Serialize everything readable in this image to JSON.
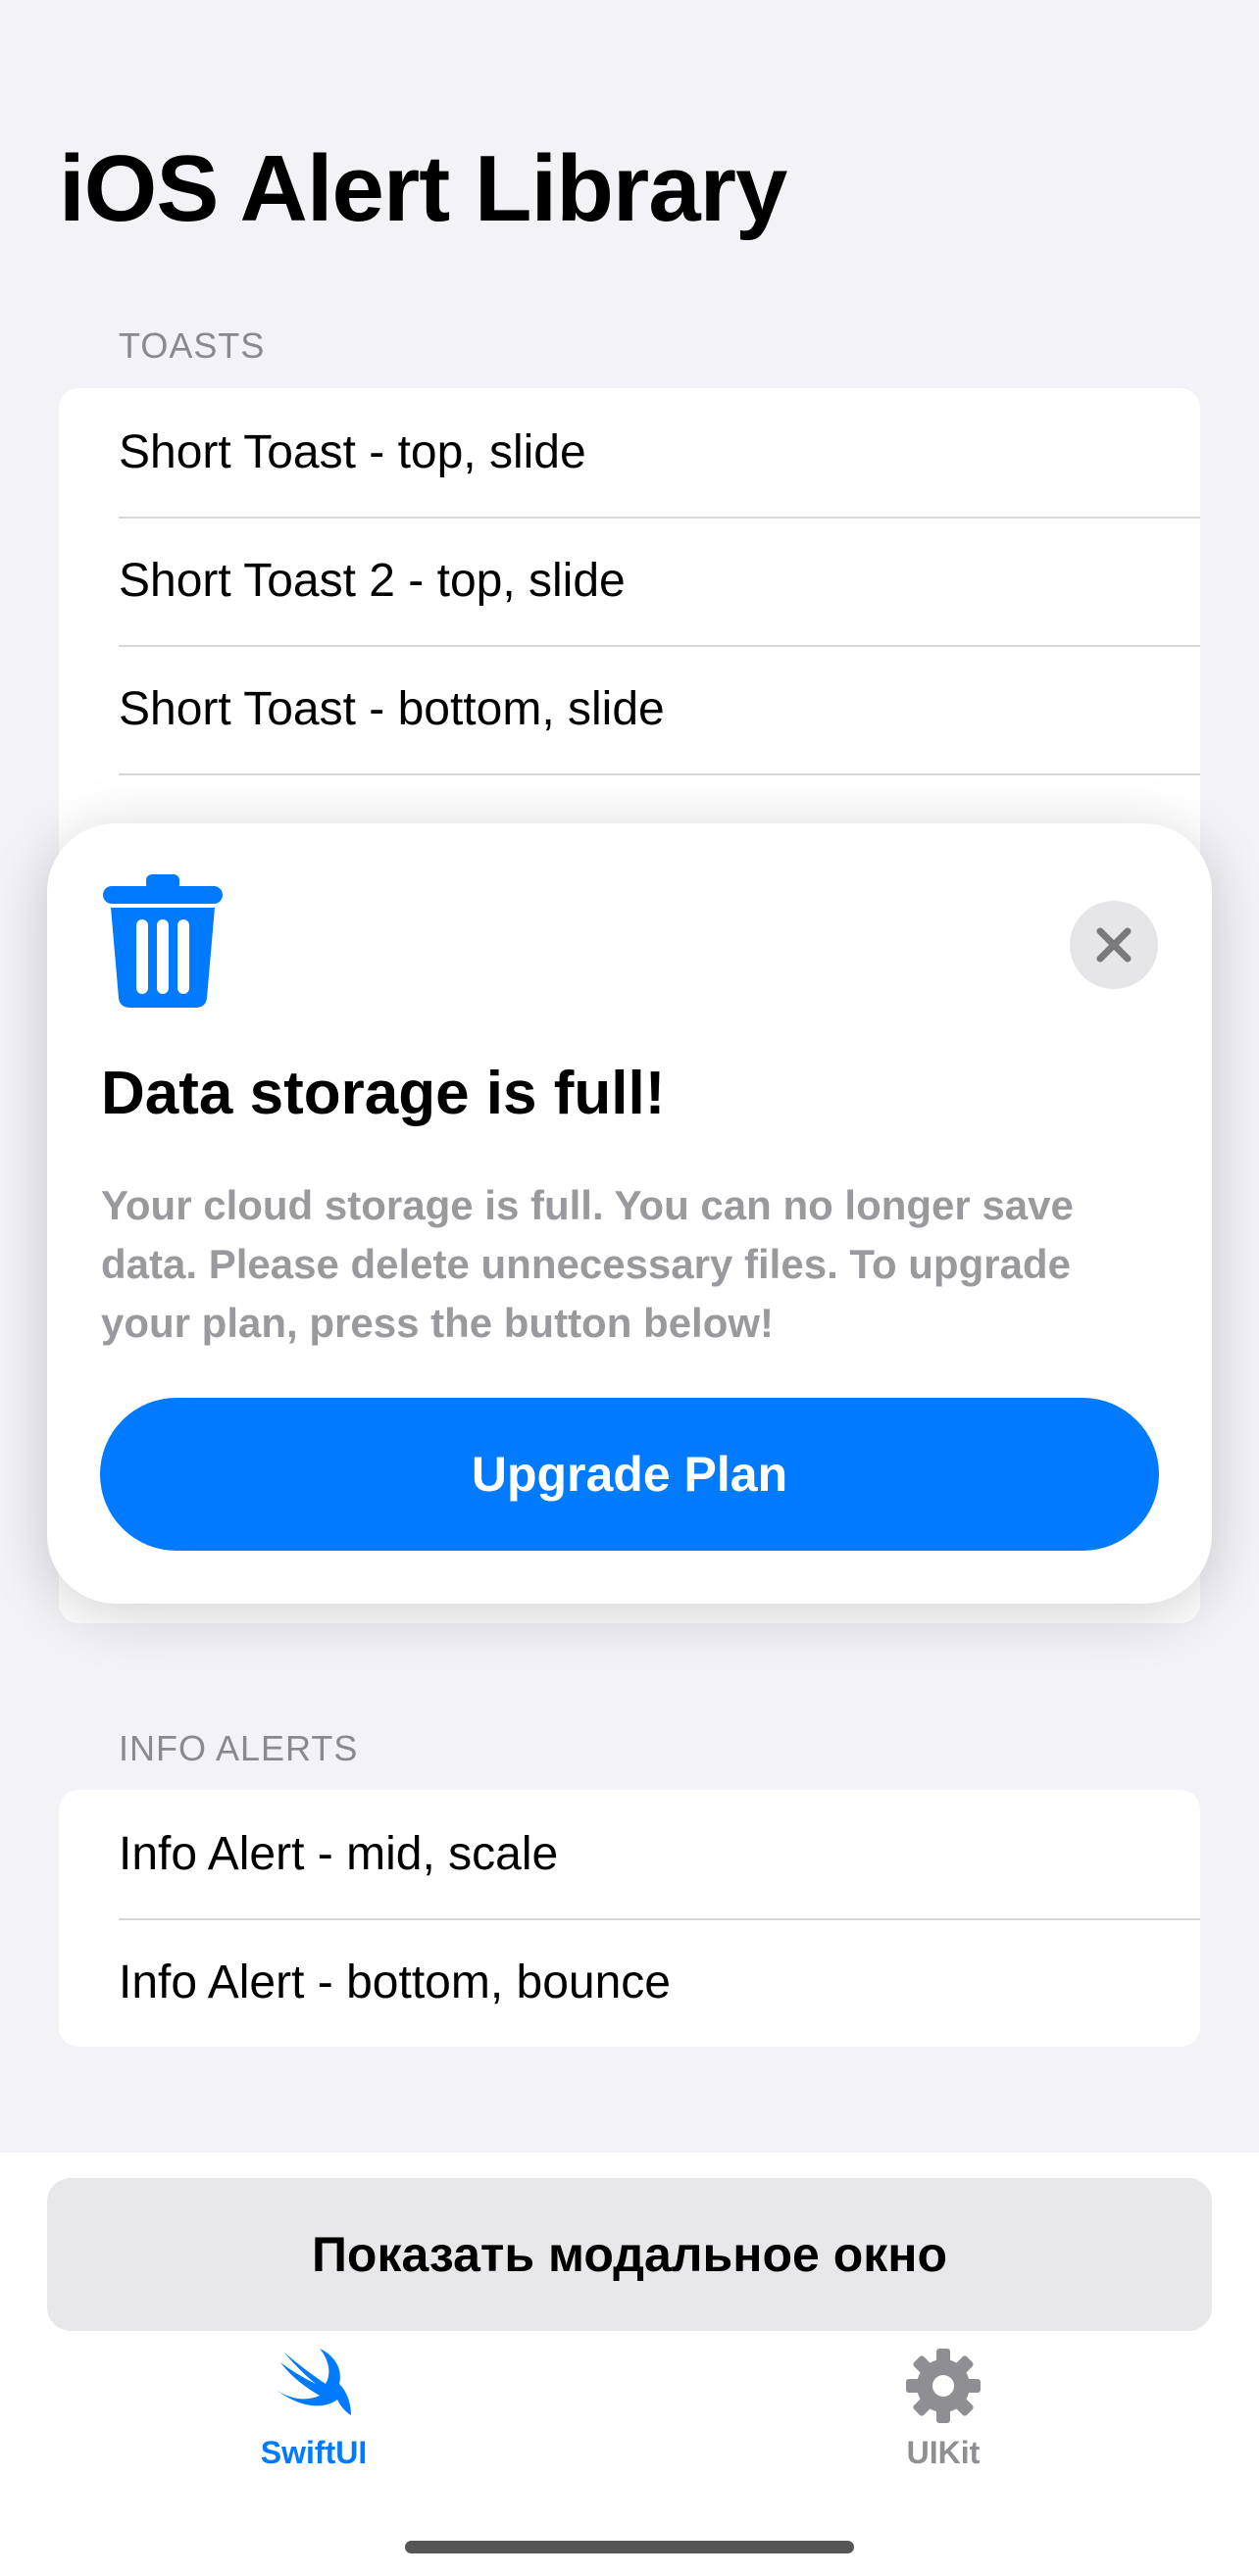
{
  "page": {
    "title": "iOS Alert Library"
  },
  "sections": [
    {
      "header": "TOASTS",
      "rows": [
        "Short Toast - top, slide",
        "Short Toast 2 - top, slide",
        "Short Toast - bottom, slide"
      ]
    },
    {
      "header": "INFO ALERTS",
      "rows": [
        "Info Alert - mid, scale",
        "Info Alert - bottom, bounce"
      ]
    }
  ],
  "alert": {
    "icon": "trash-icon",
    "title": "Data storage is full!",
    "message": "Your cloud storage is full. You can no longer save data. Please delete unnecessary files. To upgrade your plan, press the button below!",
    "button_label": "Upgrade Plan",
    "close_icon": "close-icon"
  },
  "bottom": {
    "modal_button_label": "Показать модальное окно"
  },
  "tabbar": {
    "tabs": [
      {
        "label": "SwiftUI",
        "icon": "swift-icon",
        "selected": true
      },
      {
        "label": "UIKit",
        "icon": "gear-icon",
        "selected": false
      }
    ]
  },
  "colors": {
    "accent": "#007AFF",
    "background": "#F2F2F7",
    "inactive_tab": "#8E8E93",
    "secondary_text": "#9A9A9E"
  }
}
